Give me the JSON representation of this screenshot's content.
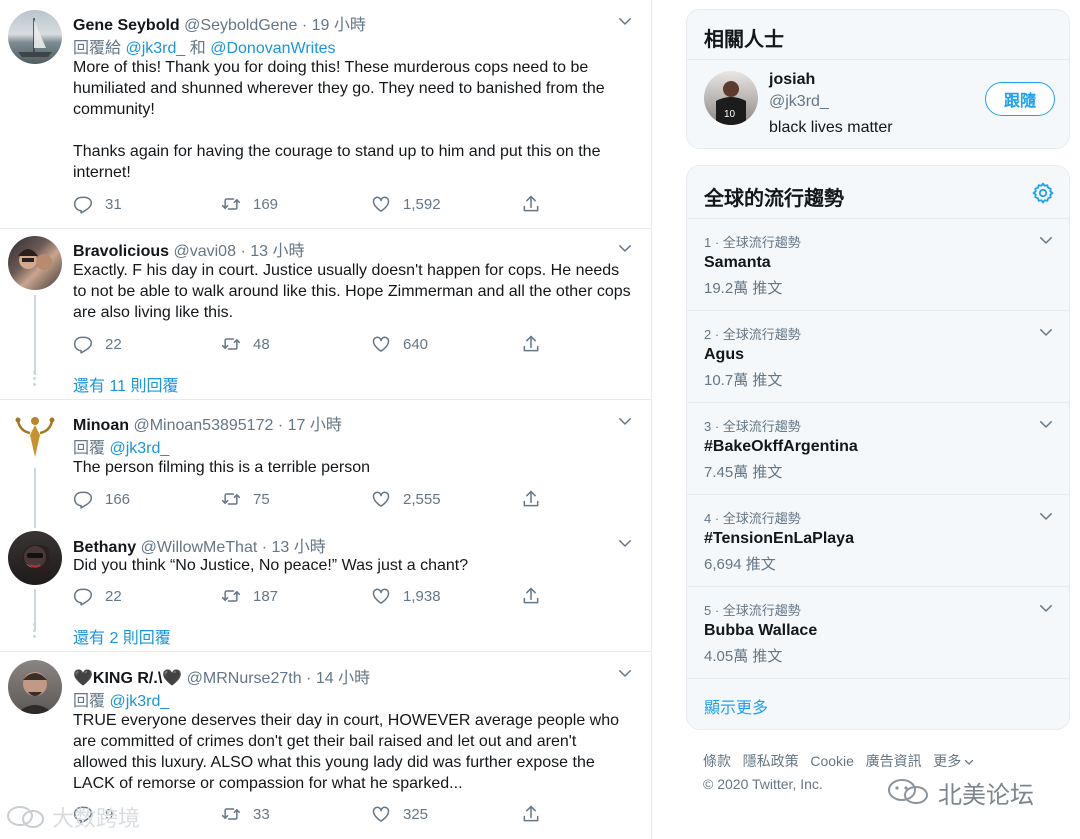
{
  "tweets": [
    {
      "name": "Gene Seybold",
      "handle": "@SeyboldGene",
      "dot": "·",
      "time": "19 小時",
      "reply_prefix": "回覆給",
      "reply_mention1": "@jk3rd_",
      "reply_and": "和",
      "reply_mention2": "@DonovanWrites",
      "text1": "More of this! Thank you for doing this! These murderous cops need to be humiliated and shunned wherever they go. They need to banished from the community!",
      "text2": "Thanks again for having the courage to stand up to him and put this on the internet!",
      "replies": "31",
      "retweets": "169",
      "likes": "1,592"
    },
    {
      "name": "Bravolicious",
      "handle": "@vavi08",
      "dot": "·",
      "time": "13 小時",
      "text": "Exactly. F his day in court. Justice usually doesn't happen for cops. He needs to not be able to walk around like this. Hope Zimmerman and all the other cops are also living like this.",
      "replies": "22",
      "retweets": "48",
      "likes": "640",
      "show_more": "還有 11 則回覆"
    },
    {
      "name": "Minoan",
      "handle": "@Minoan53895172",
      "dot": "·",
      "time": "17 小時",
      "reply_prefix": "回覆",
      "reply_mention1": "@jk3rd_",
      "text": "The person filming this is a terrible person",
      "replies": "166",
      "retweets": "75",
      "likes": "2,555"
    },
    {
      "name": "Bethany",
      "handle": "@WillowMeThat",
      "dot": "·",
      "time": "13 小時",
      "text": "Did you think “No Justice, No peace!” Was just a chant?",
      "replies": "22",
      "retweets": "187",
      "likes": "1,938",
      "show_more": "還有 2 則回覆"
    },
    {
      "name": "🖤KING R/.\\🖤",
      "handle": "@MRNurse27th",
      "dot": "·",
      "time": "14 小時",
      "reply_prefix": "回覆",
      "reply_mention1": "@jk3rd_",
      "text": "TRUE everyone deserves their day in court, HOWEVER average people who are committed of crimes don't get their bail raised and let out and aren't allowed this luxury. ALSO what this young lady did was further expose the LACK of remorse or compassion for what he sparked...",
      "replies": "9",
      "retweets": "33",
      "likes": "325"
    }
  ],
  "related": {
    "title": "相關人士",
    "name": "josiah",
    "handle": "@jk3rd_",
    "bio": "black lives matter",
    "follow_label": "跟隨"
  },
  "trends": {
    "title": "全球的流行趨勢",
    "items": [
      {
        "rank": "1 · 全球流行趨勢",
        "name": "Samanta",
        "count": "19.2萬 推文"
      },
      {
        "rank": "2 · 全球流行趨勢",
        "name": "Agus",
        "count": "10.7萬 推文"
      },
      {
        "rank": "3 · 全球流行趨勢",
        "name": "#BakeOkffArgentina",
        "count": "7.45萬 推文"
      },
      {
        "rank": "4 · 全球流行趨勢",
        "name": "#TensionEnLaPlaya",
        "count": "6,694 推文"
      },
      {
        "rank": "5 · 全球流行趨勢",
        "name": "Bubba Wallace",
        "count": "4.05萬 推文"
      }
    ],
    "show_more": "顯示更多"
  },
  "footer": {
    "terms": "條款",
    "privacy": "隱私政策",
    "cookie": "Cookie",
    "ads": "廣告資訊",
    "more": "更多",
    "copyright": "© 2020 Twitter, Inc."
  },
  "watermarks": {
    "left": "大数跨境",
    "right": "北美论坛"
  },
  "colors": {
    "accent": "#1da1f2",
    "link": "#1b95e0",
    "muted": "#657786",
    "border": "#e6ecf0"
  }
}
